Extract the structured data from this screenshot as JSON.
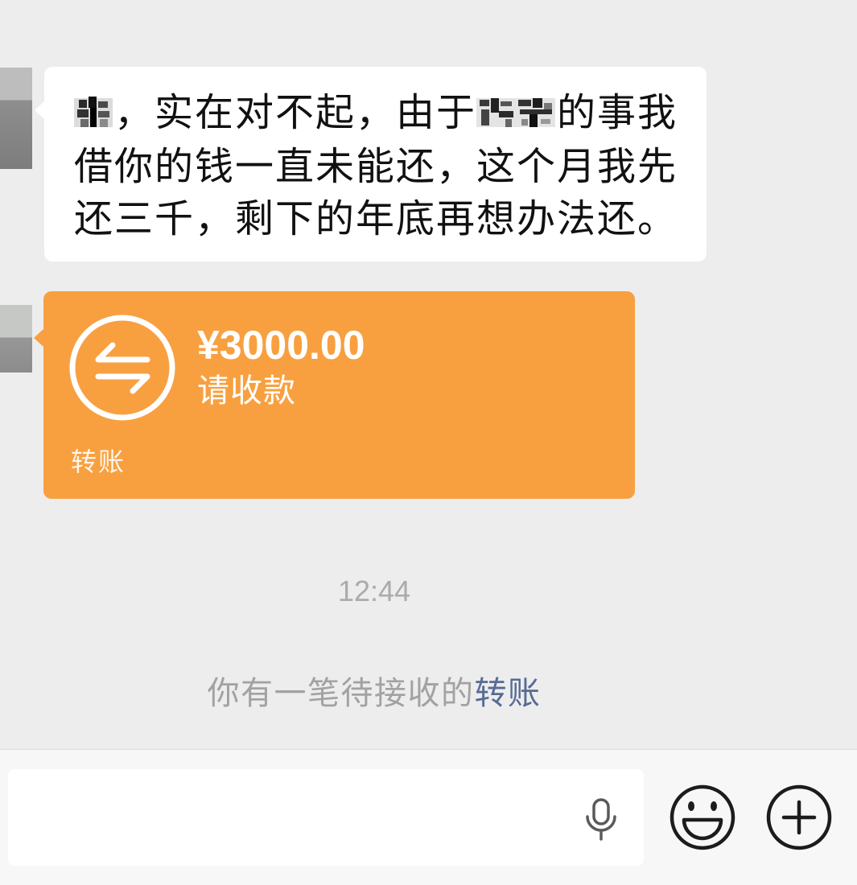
{
  "colors": {
    "chat_background": "#EDEDED",
    "bubble_background": "#FFFFFF",
    "transfer_orange": "#F8A040",
    "timestamp_gray": "#ABABAB",
    "link_blue": "#576B95",
    "input_bar_background": "#F7F7F7"
  },
  "messages": [
    {
      "type": "text",
      "line1": {
        "after_redaction_1": "，实在对不起，由于",
        "after_redaction_2": "的事我"
      },
      "line2": "借你的钱一直未能还，这个月我先",
      "line3": "还三千，剩下的年底再想办法还。"
    },
    {
      "type": "transfer",
      "icon": "transfer-arrows-icon",
      "amount": "¥3000.00",
      "status": "请收款",
      "label": "转账"
    }
  ],
  "timestamp": "12:44",
  "system_notice": {
    "prefix": "你有一笔待接收的",
    "link": "转账"
  },
  "input_bar": {
    "value": "",
    "icons": [
      "microphone-icon",
      "emoji-icon",
      "plus-icon"
    ]
  }
}
